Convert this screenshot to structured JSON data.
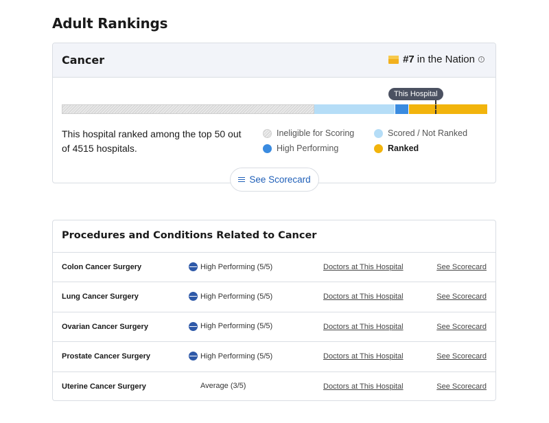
{
  "page": {
    "title": "Adult Rankings"
  },
  "specialty": {
    "name": "Cancer",
    "rank_number": "#7",
    "rank_suffix": "in the Nation",
    "info_glyph": "i",
    "this_hospital_label": "This Hospital",
    "description": "This hospital ranked among the top 50 out of 4515 hospitals.",
    "legend": [
      {
        "label": "Ineligible for Scoring",
        "color": "#d2d2d2"
      },
      {
        "label": "Scored / Not Ranked",
        "color": "#b5ddf7"
      },
      {
        "label": "High Performing",
        "color": "#3a8be0"
      },
      {
        "label": "Ranked",
        "color": "#f2b40c"
      }
    ],
    "scorecard_button": "See Scorecard"
  },
  "procedures": {
    "title": "Procedures and Conditions Related to Cancer",
    "rows": [
      {
        "name": "Colon Cancer Surgery",
        "rating": "High Performing (5/5)",
        "icon": "high-performing-icon",
        "doctors_link": "Doctors at This Hospital",
        "scorecard_link": "See Scorecard"
      },
      {
        "name": "Lung Cancer Surgery",
        "rating": "High Performing (5/5)",
        "icon": "high-performing-icon",
        "doctors_link": "Doctors at This Hospital",
        "scorecard_link": "See Scorecard"
      },
      {
        "name": "Ovarian Cancer Surgery",
        "rating": "High Performing (5/5)",
        "icon": "high-performing-icon",
        "doctors_link": "Doctors at This Hospital",
        "scorecard_link": "See Scorecard"
      },
      {
        "name": "Prostate Cancer Surgery",
        "rating": "High Performing (5/5)",
        "icon": "high-performing-icon",
        "doctors_link": "Doctors at This Hospital",
        "scorecard_link": "See Scorecard"
      },
      {
        "name": "Uterine Cancer Surgery",
        "rating": "Average (3/5)",
        "icon": "",
        "doctors_link": "Doctors at This Hospital",
        "scorecard_link": "See Scorecard"
      }
    ]
  },
  "colors": {
    "accent_link": "#1f5fb8",
    "header_bg": "#f2f4f9",
    "ranked": "#f2b40c",
    "high_performing": "#3a8be0",
    "scored": "#b5ddf7"
  }
}
